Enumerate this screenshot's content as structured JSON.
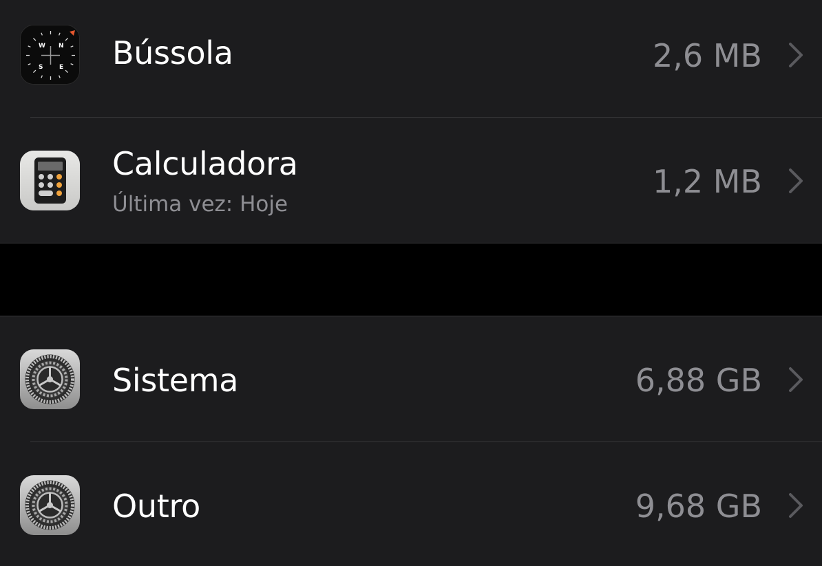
{
  "apps_section": {
    "rows": [
      {
        "name": "Bússola",
        "subtitle": "",
        "size": "2,6 MB",
        "icon": "compass-icon"
      },
      {
        "name": "Calculadora",
        "subtitle": "Última vez: Hoje",
        "size": "1,2 MB",
        "icon": "calculator-icon"
      }
    ]
  },
  "system_section": {
    "rows": [
      {
        "name": "Sistema",
        "size": "6,88 GB",
        "icon": "settings-gear-icon"
      },
      {
        "name": "Outro",
        "size": "9,68 GB",
        "icon": "settings-gear-icon"
      }
    ]
  },
  "colors": {
    "background": "#000000",
    "cell_background": "#1c1c1e",
    "primary_text": "#ffffff",
    "secondary_text": "#8e8e93",
    "separator": "#38383a",
    "chevron": "#5a5a5e",
    "calculator_orange": "#f1a33c"
  }
}
